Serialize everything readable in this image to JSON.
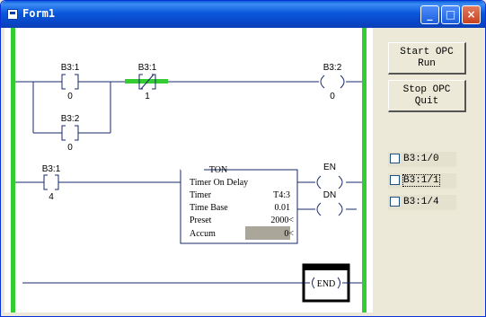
{
  "window": {
    "title": "Form1",
    "minimize_glyph": "_",
    "maximize_glyph": "□",
    "close_glyph": "×"
  },
  "buttons": {
    "start": [
      "Start OPC",
      "Run"
    ],
    "stop": [
      "Stop OPC",
      "Quit"
    ]
  },
  "checkboxes": [
    {
      "label": "B3:1/0",
      "checked": false
    },
    {
      "label": "B3:1/1",
      "checked": false,
      "focused": true
    },
    {
      "label": "B3:1/4",
      "checked": false
    }
  ],
  "ladder": {
    "rung1": {
      "contact1": {
        "address": "B3:1",
        "value": "0"
      },
      "contact2": {
        "address": "B3:1",
        "value": "1",
        "energized": true
      },
      "branch_contact": {
        "address": "B3:2",
        "value": "0"
      },
      "coil": {
        "address": "B3:2",
        "value": "0"
      }
    },
    "rung2": {
      "contact": {
        "address": "B3:1",
        "value": "4"
      },
      "ton": {
        "title": "TON",
        "subtitle": "Timer On Delay",
        "timer_label": "Timer",
        "timer_value": "T4:3",
        "timebase_label": "Time Base",
        "timebase_value": "0.01",
        "preset_label": "Preset",
        "preset_value": "2000<",
        "accum_label": "Accum",
        "accum_value": "0<"
      },
      "en_label": "EN",
      "dn_label": "DN"
    },
    "rung3": {
      "end_label": "END"
    }
  },
  "colors": {
    "rail": "#33cc33",
    "energized": "#33cc33",
    "line": "#1a2a6c",
    "titlebar": "#0a55d8"
  }
}
